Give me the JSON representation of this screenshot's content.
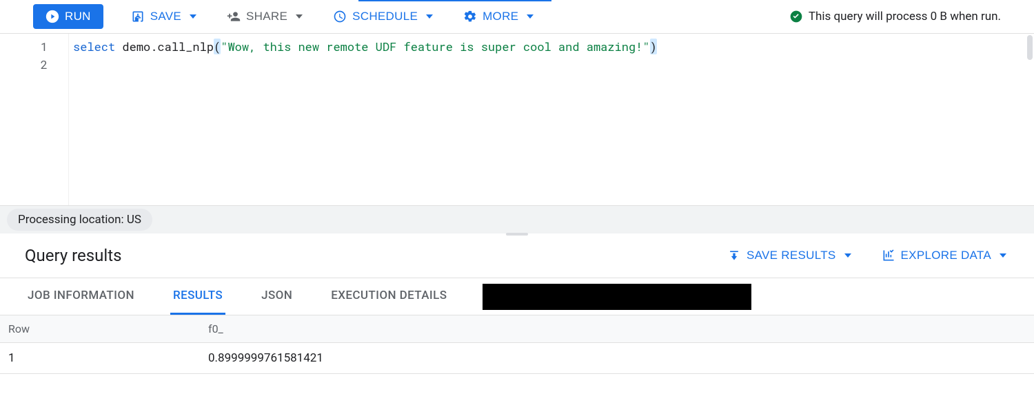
{
  "toolbar": {
    "run": "RUN",
    "save": "SAVE",
    "share": "SHARE",
    "schedule": "SCHEDULE",
    "more": "MORE"
  },
  "status": {
    "text": "This query will process 0 B when run."
  },
  "editor": {
    "line_numbers": [
      "1",
      "2"
    ],
    "code": {
      "keyword": "select",
      "func": " demo.call_nlp",
      "open_paren": "(",
      "string": "\"Wow, this new remote UDF feature is super cool and amazing!\"",
      "close_paren": ")"
    }
  },
  "location_text": "Processing location: US",
  "results_title": "Query results",
  "results_actions": {
    "save_results": "SAVE RESULTS",
    "explore_data": "EXPLORE DATA"
  },
  "tabs": {
    "job_info": "JOB INFORMATION",
    "results": "RESULTS",
    "json": "JSON",
    "execution": "EXECUTION DETAILS"
  },
  "table": {
    "headers": {
      "row": "Row",
      "f0": "f0_"
    },
    "rows": [
      {
        "row": "1",
        "f0": "0.8999999761581421"
      }
    ]
  }
}
